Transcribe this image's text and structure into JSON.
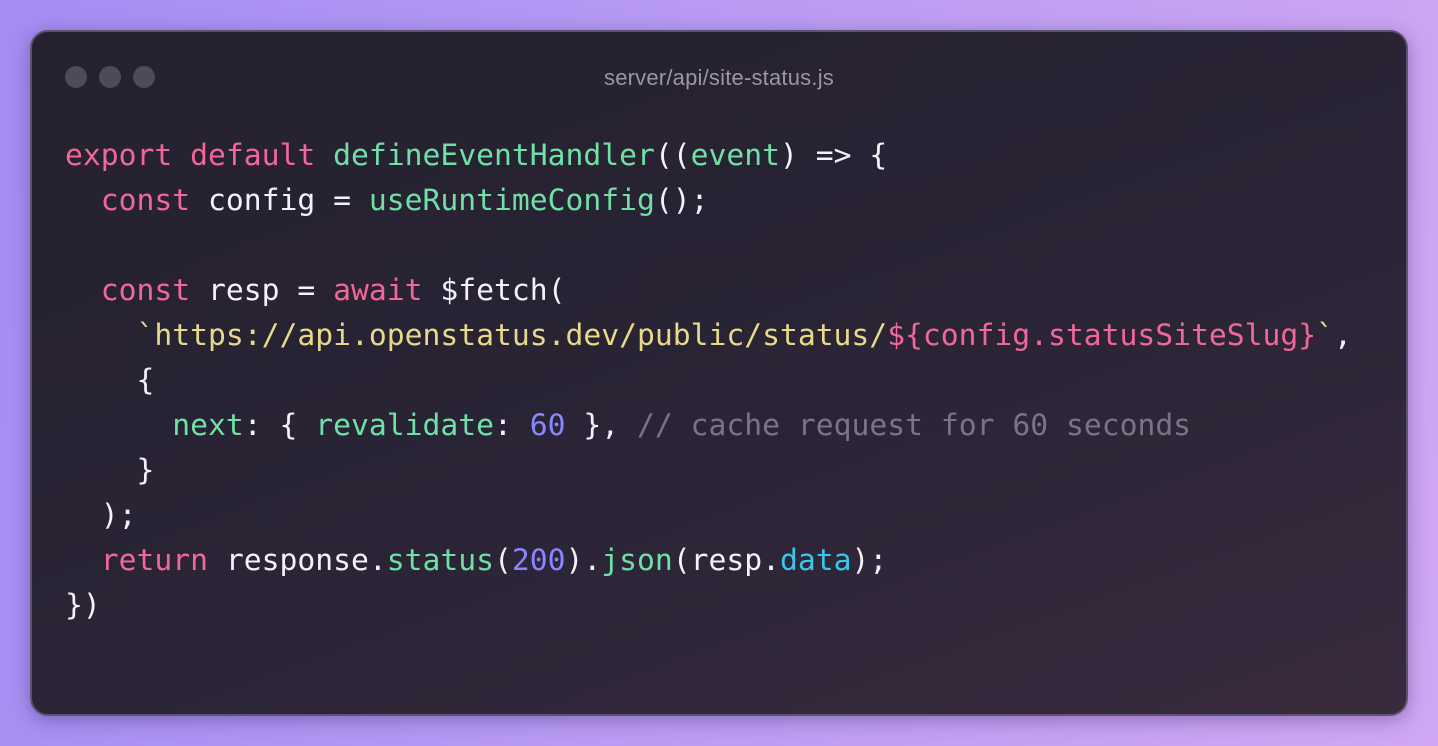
{
  "window": {
    "title": "server/api/site-status.js",
    "traffic_lights": [
      "close",
      "minimize",
      "maximize"
    ]
  },
  "code": {
    "lines": [
      [
        {
          "t": "export",
          "k": "kw"
        },
        {
          "t": " ",
          "k": "pl"
        },
        {
          "t": "default",
          "k": "kw"
        },
        {
          "t": " ",
          "k": "pl"
        },
        {
          "t": "defineEventHandler",
          "k": "fn"
        },
        {
          "t": "((",
          "k": "pl"
        },
        {
          "t": "event",
          "k": "prop"
        },
        {
          "t": ") => {",
          "k": "pl"
        }
      ],
      [
        {
          "t": "  ",
          "k": "pl"
        },
        {
          "t": "const",
          "k": "kw"
        },
        {
          "t": " config = ",
          "k": "pl"
        },
        {
          "t": "useRuntimeConfig",
          "k": "fn"
        },
        {
          "t": "();",
          "k": "pl"
        }
      ],
      [],
      [
        {
          "t": "  ",
          "k": "pl"
        },
        {
          "t": "const",
          "k": "kw"
        },
        {
          "t": " resp = ",
          "k": "pl"
        },
        {
          "t": "await",
          "k": "kw"
        },
        {
          "t": " $fetch(",
          "k": "pl"
        }
      ],
      [
        {
          "t": "    ",
          "k": "pl"
        },
        {
          "t": "`https://api.openstatus.dev/public/status/",
          "k": "str"
        },
        {
          "t": "${config.statusSiteSlug}",
          "k": "interp"
        },
        {
          "t": "`",
          "k": "str"
        },
        {
          "t": ",",
          "k": "pl"
        }
      ],
      [
        {
          "t": "    {",
          "k": "pl"
        }
      ],
      [
        {
          "t": "      ",
          "k": "pl"
        },
        {
          "t": "next",
          "k": "prop"
        },
        {
          "t": ": { ",
          "k": "pl"
        },
        {
          "t": "revalidate",
          "k": "prop"
        },
        {
          "t": ": ",
          "k": "pl"
        },
        {
          "t": "60",
          "k": "num"
        },
        {
          "t": " }, ",
          "k": "pl"
        },
        {
          "t": "// cache request for 60 seconds",
          "k": "cm"
        }
      ],
      [
        {
          "t": "    }",
          "k": "pl"
        }
      ],
      [
        {
          "t": "  );",
          "k": "pl"
        }
      ],
      [
        {
          "t": "  ",
          "k": "pl"
        },
        {
          "t": "return",
          "k": "kw"
        },
        {
          "t": " response.",
          "k": "pl"
        },
        {
          "t": "status",
          "k": "fn"
        },
        {
          "t": "(",
          "k": "pl"
        },
        {
          "t": "200",
          "k": "num"
        },
        {
          "t": ").",
          "k": "pl"
        },
        {
          "t": "json",
          "k": "fn"
        },
        {
          "t": "(resp.",
          "k": "pl"
        },
        {
          "t": "data",
          "k": "acc"
        },
        {
          "t": ");",
          "k": "pl"
        }
      ],
      [
        {
          "t": "})",
          "k": "pl"
        }
      ]
    ]
  }
}
